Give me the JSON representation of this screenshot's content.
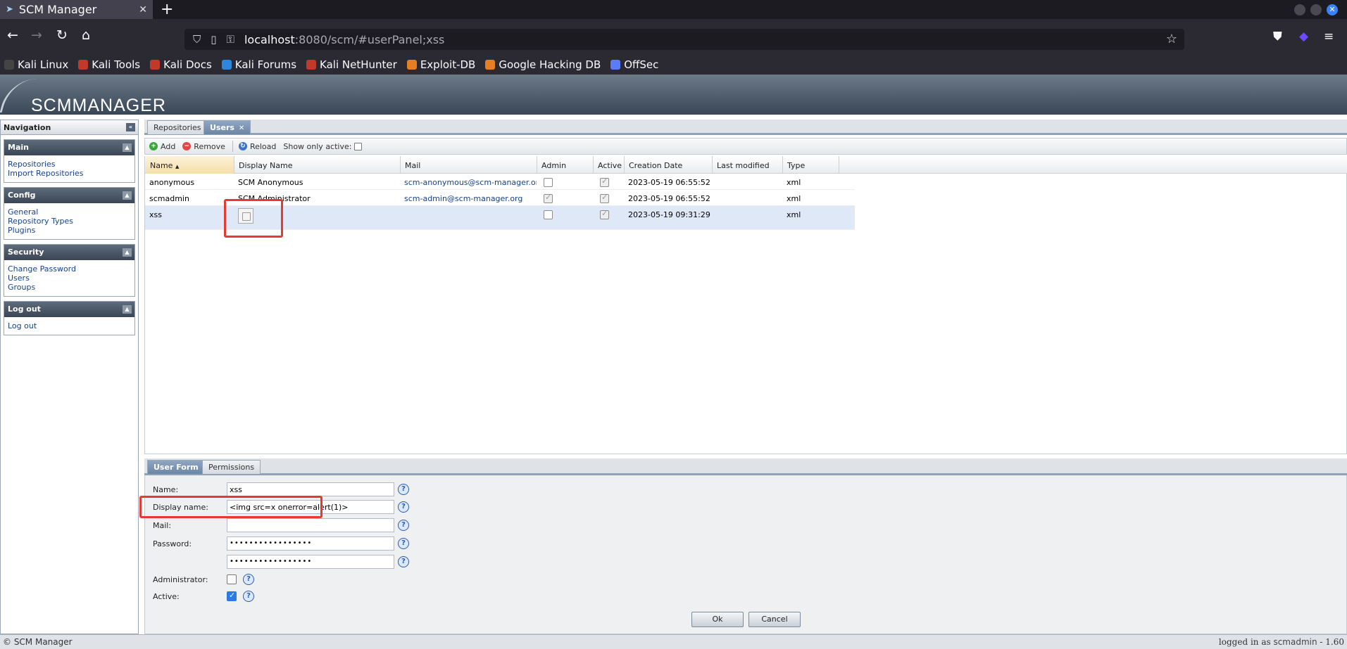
{
  "browser": {
    "tab_title": "SCM Manager",
    "url_host": "localhost",
    "url_path": ":8080/scm/#userPanel;xss",
    "bookmarks": [
      {
        "label": "Kali Linux",
        "color": "#444"
      },
      {
        "label": "Kali Tools",
        "color": "#c0392b"
      },
      {
        "label": "Kali Docs",
        "color": "#c0392b"
      },
      {
        "label": "Kali Forums",
        "color": "#2e86de"
      },
      {
        "label": "Kali NetHunter",
        "color": "#c0392b"
      },
      {
        "label": "Exploit-DB",
        "color": "#e67e22"
      },
      {
        "label": "Google Hacking DB",
        "color": "#e67e22"
      },
      {
        "label": "OffSec",
        "color": "#5b7cfa"
      }
    ]
  },
  "app": {
    "brand": "SCMMANAGER"
  },
  "navigation": {
    "title": "Navigation",
    "groups": [
      {
        "title": "Main",
        "items": [
          "Repositories",
          "Import Repositories"
        ]
      },
      {
        "title": "Config",
        "items": [
          "General",
          "Repository Types",
          "Plugins"
        ]
      },
      {
        "title": "Security",
        "items": [
          "Change Password",
          "Users",
          "Groups"
        ]
      },
      {
        "title": "Log out",
        "items": [
          "Log out"
        ]
      }
    ]
  },
  "main_tabs": [
    {
      "label": "Repositories",
      "active": false
    },
    {
      "label": "Users",
      "active": true
    }
  ],
  "toolbar": {
    "add": "Add",
    "remove": "Remove",
    "reload": "Reload",
    "show_only_active": "Show only active:"
  },
  "grid": {
    "columns": [
      "Name",
      "Display Name",
      "Mail",
      "Admin",
      "Active",
      "Creation Date",
      "Last modified",
      "Type"
    ],
    "rows": [
      {
        "name": "anonymous",
        "display": "SCM Anonymous",
        "mail": "scm-anonymous@scm-manager.org",
        "admin": false,
        "active": true,
        "created": "2023-05-19 06:55:52",
        "modified": "",
        "type": "xml"
      },
      {
        "name": "scmadmin",
        "display": "SCM Administrator",
        "mail": "scm-admin@scm-manager.org",
        "admin": true,
        "active": true,
        "created": "2023-05-19 06:55:52",
        "modified": "",
        "type": "xml"
      },
      {
        "name": "xss",
        "display": "",
        "mail": "",
        "admin": false,
        "active": true,
        "created": "2023-05-19 09:31:29",
        "modified": "",
        "type": "xml"
      }
    ]
  },
  "form_tabs": [
    {
      "label": "User Form",
      "active": true
    },
    {
      "label": "Permissions",
      "active": false
    }
  ],
  "form": {
    "name_label": "Name:",
    "name_value": "xss",
    "display_label": "Display name:",
    "display_value": "<img src=x onerror=alert(1)>",
    "mail_label": "Mail:",
    "mail_value": "",
    "password_label": "Password:",
    "password_value": "•••••••••••••••••",
    "confirm_value": "•••••••••••••••••",
    "admin_label": "Administrator:",
    "admin_checked": false,
    "active_label": "Active:",
    "active_checked": true,
    "ok": "Ok",
    "cancel": "Cancel"
  },
  "footer": {
    "left": "© SCM Manager",
    "right_prefix": "logged in as ",
    "user": "scmadmin",
    "right_suffix": " - 1.60"
  }
}
